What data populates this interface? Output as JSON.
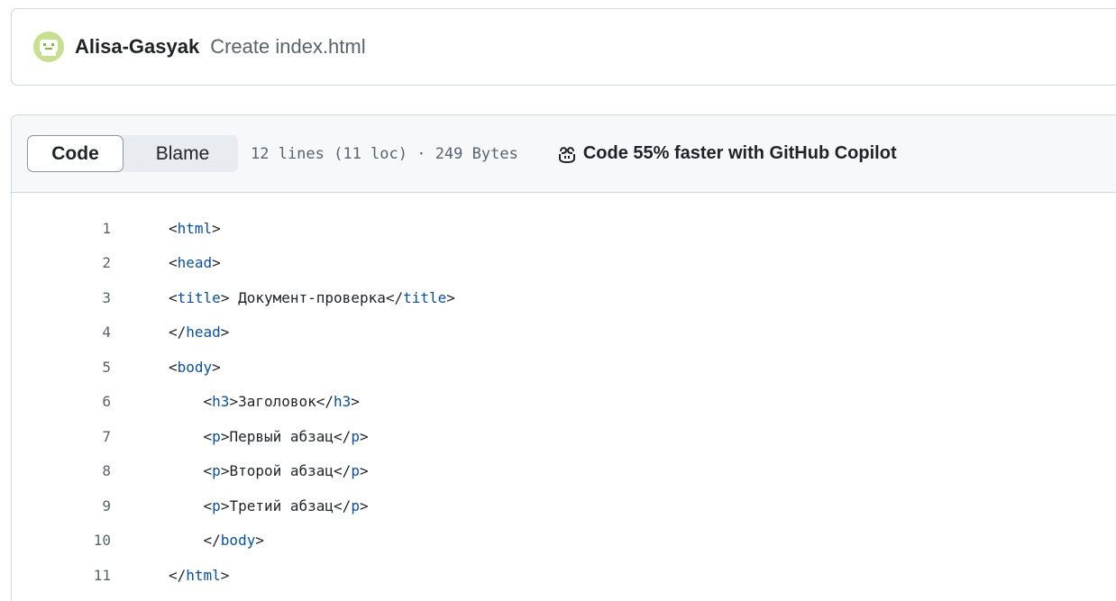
{
  "commit": {
    "author": "Alisa-Gasyak",
    "message": "Create index.html"
  },
  "file_header": {
    "tabs": [
      {
        "label": "Code",
        "selected": true
      },
      {
        "label": "Blame",
        "selected": false
      }
    ],
    "file_info": "12 lines (11 loc) · 249 Bytes",
    "copilot_label": "Code 55% faster with GitHub Copilot",
    "copilot_icon": "copilot-icon"
  },
  "code_lines": [
    {
      "num": "1",
      "indent": "",
      "parts": [
        [
          "p",
          "<"
        ],
        [
          "t",
          "html"
        ],
        [
          "p",
          ">"
        ]
      ]
    },
    {
      "num": "2",
      "indent": "",
      "parts": [
        [
          "p",
          "<"
        ],
        [
          "t",
          "head"
        ],
        [
          "p",
          ">"
        ]
      ]
    },
    {
      "num": "3",
      "indent": "",
      "parts": [
        [
          "p",
          "<"
        ],
        [
          "t",
          "title"
        ],
        [
          "p",
          "> Документ-проверка</"
        ],
        [
          "t",
          "title"
        ],
        [
          "p",
          ">"
        ]
      ]
    },
    {
      "num": "4",
      "indent": "",
      "parts": [
        [
          "p",
          "</"
        ],
        [
          "t",
          "head"
        ],
        [
          "p",
          ">"
        ]
      ]
    },
    {
      "num": "5",
      "indent": "",
      "parts": [
        [
          "p",
          "<"
        ],
        [
          "t",
          "body"
        ],
        [
          "p",
          ">"
        ]
      ]
    },
    {
      "num": "6",
      "indent": "    ",
      "parts": [
        [
          "p",
          "<"
        ],
        [
          "t",
          "h3"
        ],
        [
          "p",
          ">Заголовок</"
        ],
        [
          "t",
          "h3"
        ],
        [
          "p",
          ">"
        ]
      ]
    },
    {
      "num": "7",
      "indent": "    ",
      "parts": [
        [
          "p",
          "<"
        ],
        [
          "t",
          "p"
        ],
        [
          "p",
          ">Первый абзац</"
        ],
        [
          "t",
          "p"
        ],
        [
          "p",
          ">"
        ]
      ]
    },
    {
      "num": "8",
      "indent": "    ",
      "parts": [
        [
          "p",
          "<"
        ],
        [
          "t",
          "p"
        ],
        [
          "p",
          ">Второй абзац</"
        ],
        [
          "t",
          "p"
        ],
        [
          "p",
          ">"
        ]
      ]
    },
    {
      "num": "9",
      "indent": "    ",
      "parts": [
        [
          "p",
          "<"
        ],
        [
          "t",
          "p"
        ],
        [
          "p",
          ">Третий абзац</"
        ],
        [
          "t",
          "p"
        ],
        [
          "p",
          ">"
        ]
      ]
    },
    {
      "num": "10",
      "indent": "    ",
      "parts": [
        [
          "p",
          "</"
        ],
        [
          "t",
          "body"
        ],
        [
          "p",
          ">"
        ]
      ]
    },
    {
      "num": "11",
      "indent": "",
      "parts": [
        [
          "p",
          "</"
        ],
        [
          "t",
          "html"
        ],
        [
          "p",
          ">"
        ]
      ]
    }
  ],
  "colors": {
    "tag": "#0550ae",
    "text": "#1f2328",
    "muted": "#59636e",
    "border": "#d0d7de",
    "header_bg": "#f6f8fa"
  }
}
